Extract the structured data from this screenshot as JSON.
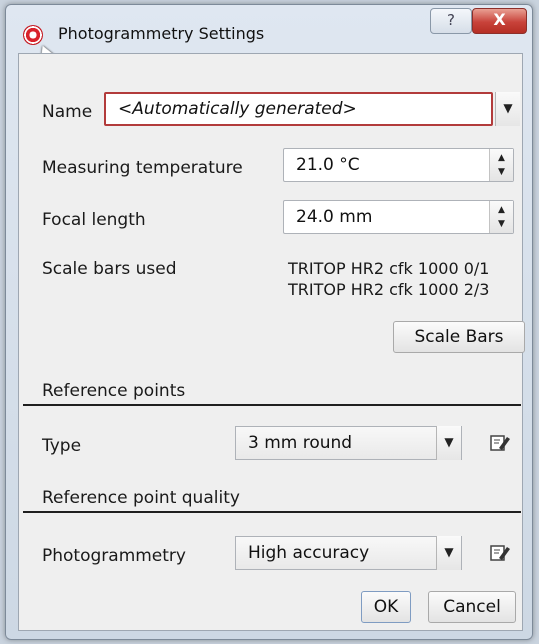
{
  "window": {
    "title": "Photogrammetry Settings",
    "help_glyph": "?",
    "close_glyph": "X"
  },
  "form": {
    "name_label": "Name",
    "name_value": "<Automatically generated>",
    "temp_label": "Measuring temperature",
    "temp_value": "21.0 °C",
    "focal_label": "Focal length",
    "focal_value": "24.0 mm",
    "scale_label": "Scale bars used",
    "scale_bars": [
      "TRITOP HR2 cfk 1000 0/1",
      "TRITOP HR2 cfk 1000 2/3"
    ],
    "scale_button": "Scale Bars"
  },
  "reference_points": {
    "section_title": "Reference points",
    "type_label": "Type",
    "type_value": "3 mm round"
  },
  "reference_quality": {
    "section_title": "Reference point quality",
    "mode_label": "Photogrammetry",
    "mode_value": "High accuracy"
  },
  "buttons": {
    "ok": "OK",
    "cancel": "Cancel"
  },
  "icons": [
    "app-icon",
    "help-icon",
    "close-icon",
    "dropdown-arrow-icon",
    "spinner-icon",
    "edit-icon",
    "mouse-cursor-icon"
  ]
}
